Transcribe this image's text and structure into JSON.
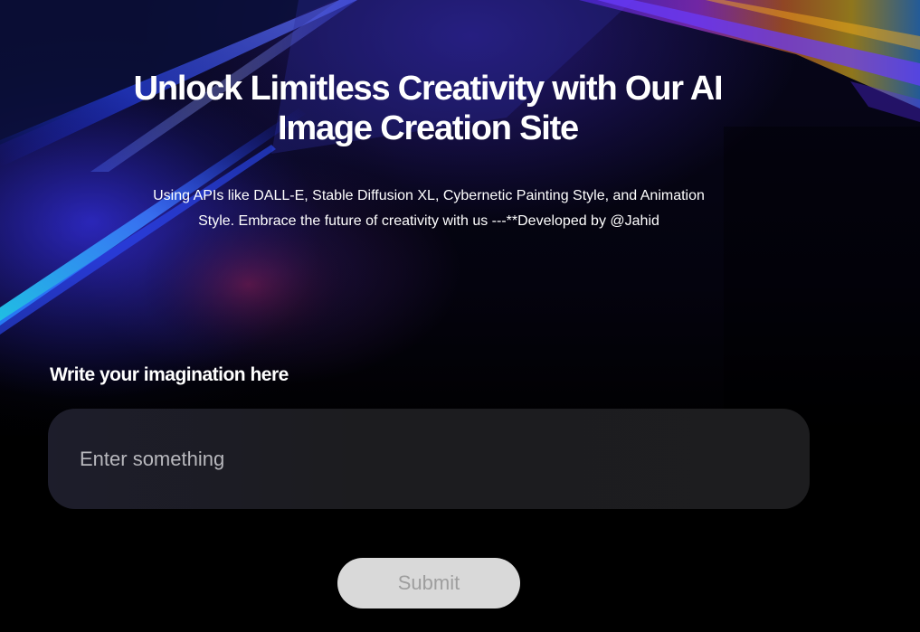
{
  "hero": {
    "title": "Unlock Limitless Creativity with Our AI Image Creation Site",
    "subtitle": "Using APIs like DALL-E, Stable Diffusion XL, Cybernetic Painting Style, and Animation Style. Embrace the future of creativity with us ---**Developed by @Jahid"
  },
  "prompt": {
    "label": "Write your imagination here",
    "value": "",
    "placeholder": "Enter something"
  },
  "submit": {
    "label": "Submit"
  },
  "colors": {
    "background": "#000000",
    "text": "#ffffff",
    "input_background": "#1c1c1f",
    "button_background": "#d9d9d9",
    "button_text": "#9e9e9e"
  }
}
